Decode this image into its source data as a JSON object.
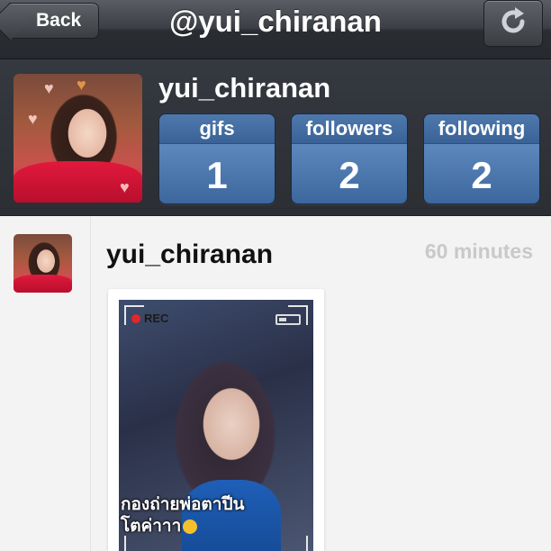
{
  "navbar": {
    "back_label": "Back",
    "title": "@yui_chiranan",
    "refresh_icon": "refresh-icon"
  },
  "profile": {
    "username": "yui_chiranan",
    "stats": [
      {
        "label": "gifs",
        "value": "1"
      },
      {
        "label": "followers",
        "value": "2"
      },
      {
        "label": "following",
        "value": "2"
      }
    ]
  },
  "feed": {
    "post": {
      "username": "yui_chiranan",
      "time": "60 minutes",
      "image": {
        "rec_label": "REC",
        "caption_line1": "กองถ่ายพ่อตาปีน",
        "caption_line2": "โตค่าาา"
      }
    }
  },
  "colors": {
    "navbar": "#3b3f45",
    "header_bg": "#2f3237",
    "stat_blue": "#4a73a8",
    "feed_bg": "#f3f3f3",
    "time_gray": "#c9c9c9"
  }
}
